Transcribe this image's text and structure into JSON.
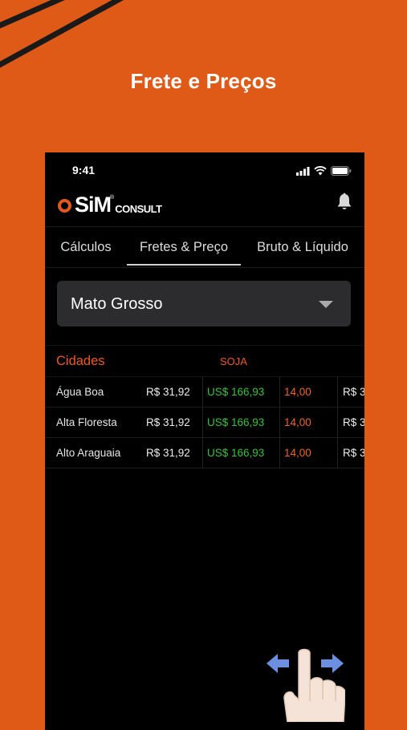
{
  "promo": {
    "title": "Frete e Preços"
  },
  "status_bar": {
    "time": "9:41"
  },
  "brand": {
    "logo_main": "SiM",
    "logo_sub": "CONSULT",
    "logo_reg": "®",
    "accent": "#e05a17"
  },
  "tabs": [
    {
      "label": "Cálculos",
      "active": false
    },
    {
      "label": "Fretes & Preço",
      "active": true
    },
    {
      "label": "Bruto & Líquido",
      "active": false
    }
  ],
  "state_select": {
    "value": "Mato Grosso"
  },
  "table": {
    "city_header": "Cidades",
    "group_header": "SOJA",
    "rows": [
      {
        "city": "Água Boa",
        "price_brl": "R$ 31,92",
        "price_usd": "US$ 166,93",
        "value": "14,00",
        "next": "R$ 3"
      },
      {
        "city": "Alta Floresta",
        "price_brl": "R$ 31,92",
        "price_usd": "US$ 166,93",
        "value": "14,00",
        "next": "R$ 3"
      },
      {
        "city": "Alto Araguaia",
        "price_brl": "R$ 31,92",
        "price_usd": "US$ 166,93",
        "value": "14,00",
        "next": "R$ 3"
      }
    ]
  },
  "colors": {
    "background": "#e05a17",
    "usd_green": "#37c137",
    "value_orange": "#ef6424"
  },
  "icons": [
    "signal-icon",
    "wifi-icon",
    "battery-icon",
    "bell-icon",
    "swipe-hand-icon",
    "arrow-left-icon",
    "arrow-right-icon"
  ]
}
